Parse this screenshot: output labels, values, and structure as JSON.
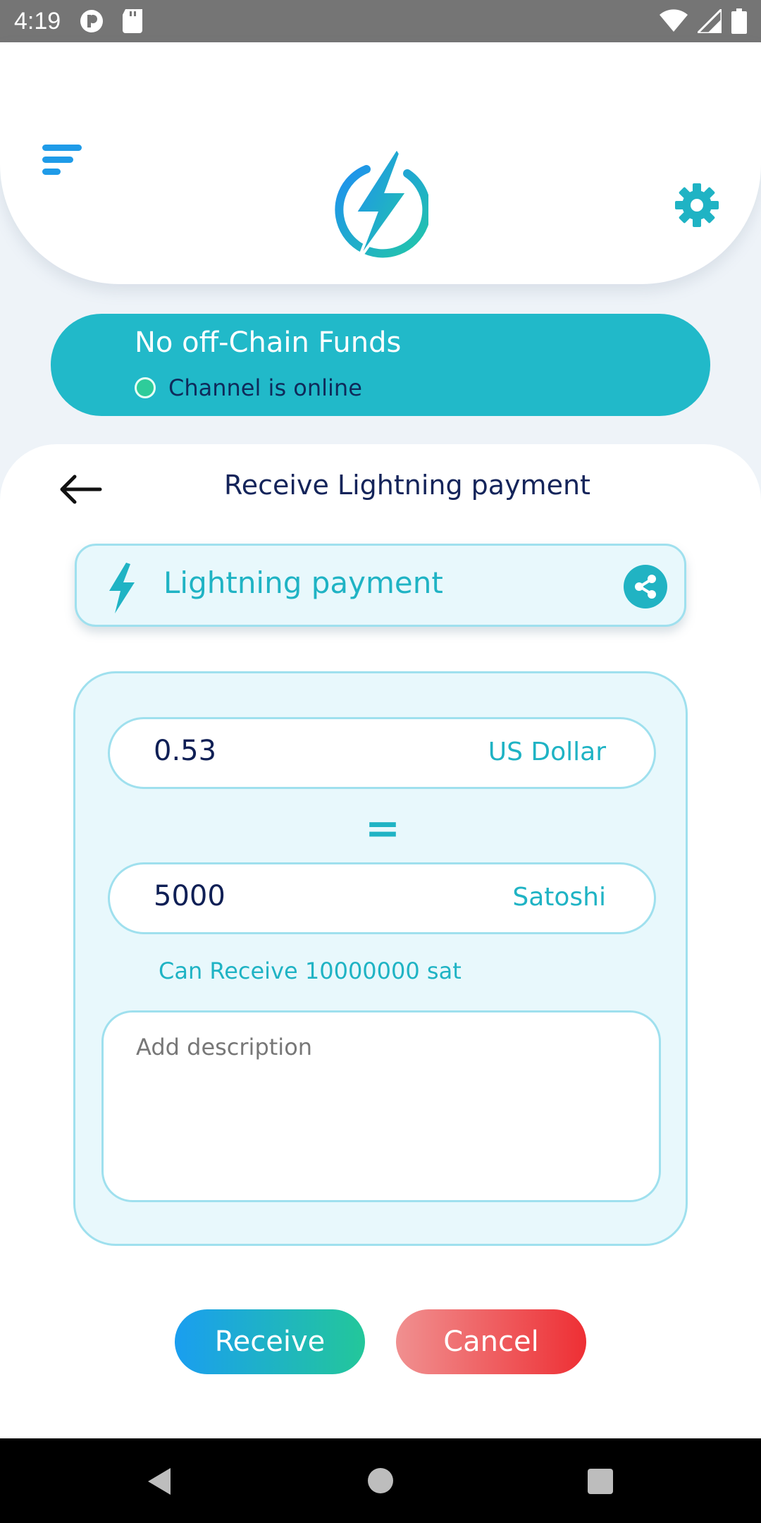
{
  "status_bar": {
    "time": "4:19",
    "icons": [
      "p-icon",
      "sd-card-icon",
      "wifi-icon",
      "signal-icon",
      "battery-icon"
    ]
  },
  "header": {
    "menu_icon": "menu-icon",
    "logo_icon": "lightning-logo-icon",
    "settings_icon": "gear-icon"
  },
  "funds": {
    "title": "No off-Chain Funds",
    "channel_status": "Channel is online"
  },
  "receive": {
    "title": "Receive Lightning payment",
    "payment_type_label": "Lightning payment",
    "usd_value": "0.53",
    "usd_unit": "US Dollar",
    "equals": "=",
    "sat_value": "5000",
    "sat_unit": "Satoshi",
    "can_receive": "Can Receive 10000000 sat",
    "description_placeholder": "Add description",
    "receive_label": "Receive",
    "cancel_label": "Cancel"
  },
  "colors": {
    "accent": "#21b9c9",
    "primary_blue": "#1f9be8",
    "cancel_red": "#ee2f34",
    "online_green": "#2ecc9a"
  }
}
